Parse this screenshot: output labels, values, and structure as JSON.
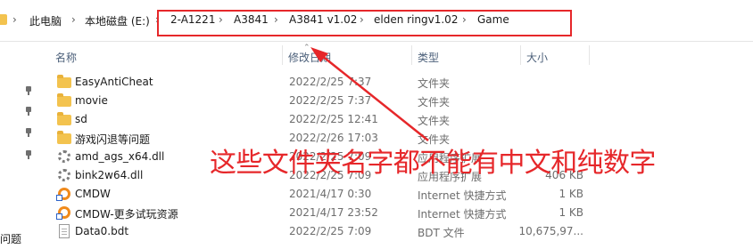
{
  "address_bar": {
    "segments": [
      "此电脑",
      "本地磁盘 (E:)",
      "2-A1221",
      "A3841",
      "A3841 v1.02",
      "elden ringv1.02",
      "Game"
    ]
  },
  "columns": {
    "name": "名称",
    "date": "修改日期",
    "type": "类型",
    "size": "大小"
  },
  "nav": {
    "bottom_label": "问题"
  },
  "files": [
    {
      "name": "EasyAntiCheat",
      "date": "2022/2/25 7:37",
      "type": "文件夹",
      "size": "",
      "icon": "folder-icon"
    },
    {
      "name": "movie",
      "date": "2022/2/25 7:37",
      "type": "文件夹",
      "size": "",
      "icon": "folder-icon"
    },
    {
      "name": "sd",
      "date": "2022/2/25 12:41",
      "type": "文件夹",
      "size": "",
      "icon": "folder-icon"
    },
    {
      "name": "游戏闪退等问题",
      "date": "2022/2/26 17:03",
      "type": "文件夹",
      "size": "",
      "icon": "folder-icon"
    },
    {
      "name": "amd_ags_x64.dll",
      "date": "2022/2/25 7:09",
      "type": "应用程序扩展",
      "size": "",
      "icon": "dll-file-icon"
    },
    {
      "name": "bink2w64.dll",
      "date": "2022/2/25 7:09",
      "type": "应用程序扩展",
      "size": "406 KB",
      "icon": "dll-file-icon"
    },
    {
      "name": "CMDW",
      "date": "2021/4/17 0:30",
      "type": "Internet 快捷方式",
      "size": "1 KB",
      "icon": "shortcut-icon"
    },
    {
      "name": "CMDW-更多试玩资源",
      "date": "2021/4/17 23:52",
      "type": "Internet 快捷方式",
      "size": "1 KB",
      "icon": "shortcut-icon"
    },
    {
      "name": "Data0.bdt",
      "date": "2022/2/25 7:09",
      "type": "BDT 文件",
      "size": "10,675,97...",
      "icon": "file-icon"
    }
  ],
  "annotation": {
    "text": "这些文件夹名字都不能有中文和纯数字",
    "color": "#e6272a"
  },
  "colors": {
    "highlight": "#e6272a",
    "folder": "#f3c34f",
    "header_text": "#4c607a"
  }
}
